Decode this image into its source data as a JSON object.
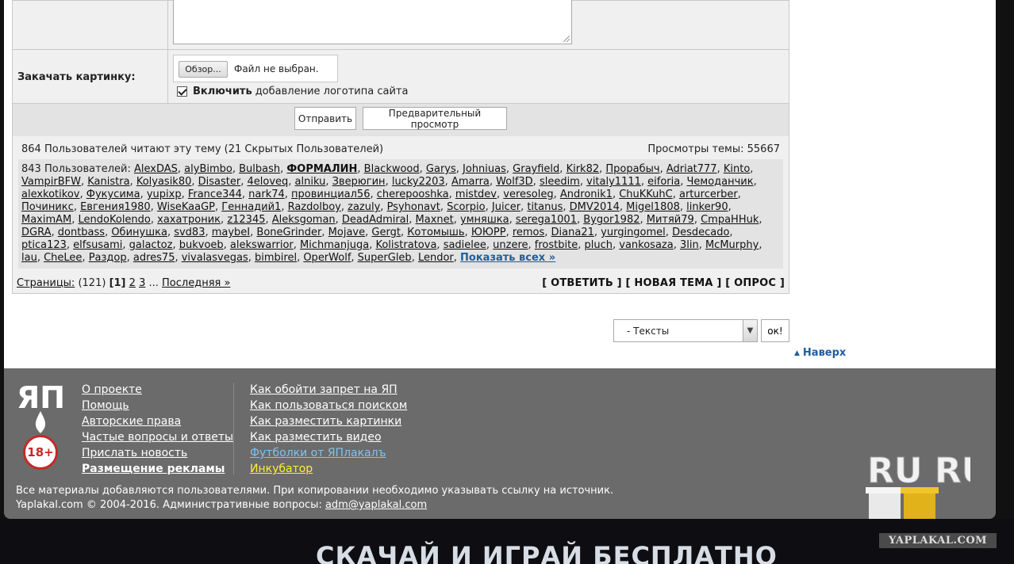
{
  "upload": {
    "label": "Закачать картинку:",
    "browse_label": "Обзор...",
    "file_status": "Файл не выбран.",
    "logo_checkbox_bold": "Включить",
    "logo_checkbox_rest": "добавление логотипа сайта"
  },
  "buttons": {
    "submit": "Отправить",
    "preview": "Предварительный просмотр"
  },
  "readers": {
    "heading": "864 Пользователей читают эту тему (21 Скрытых Пользователей)",
    "views": "Просмотры темы: 55667",
    "users_prefix": "843 Пользователей:",
    "users": [
      "AlexDAS",
      "alyBimbo",
      "Bulbash",
      "ФОРМАЛИН",
      "Blackwood",
      "Garys",
      "Johniuas",
      "Grayfield",
      "Kirk82",
      "Прорабыч",
      "Adriat777",
      "Kinto",
      "VampirBFW",
      "Kanistra",
      "Kolyasik80",
      "Disaster",
      "4eloveq",
      "alniku",
      "Зверюгин",
      "lucky2203",
      "Amarra",
      "Wolf3D",
      "sleedim",
      "vitaly1111",
      "eiforia",
      "Чемоданчик",
      "alexkotikov",
      "Фукусима",
      "yupixp",
      "France344",
      "nark74",
      "провинциал56",
      "cherepooshka",
      "mistdev",
      "veresoleg",
      "Andronik1",
      "ChuKKuhC",
      "arturcerber",
      "Починикс",
      "Евгения1980",
      "WiseKaaGP",
      "Геннадий1",
      "Razdolboy",
      "zazuly",
      "Psyhonavt",
      "Scorpio",
      "Juicer",
      "titanus",
      "DMV2014",
      "Migel1808",
      "linker90",
      "MaximAM",
      "LendoKolendo",
      "хахатроник",
      "z12345",
      "Aleksgoman",
      "DeadAdmiral",
      "Maxnet",
      "умняшка",
      "serega1001",
      "Bygor1982",
      "Митяй79",
      "СmpaHHuk",
      "DGRA",
      "dontbass",
      "Обинушка",
      "svd83",
      "maybeI",
      "BoneGrinder",
      "Mojave",
      "Gergt",
      "Котомышь",
      "ЮЮРР",
      "remos",
      "Diana21",
      "yurgingomel",
      "Desdecado",
      "ptica123",
      "elfsusami",
      "galactoz",
      "bukvoeb",
      "alekswarrior",
      "Michmanjuga",
      "Kolistratova",
      "sadielee",
      "unzere",
      "frostbite",
      "pluch",
      "vankosaza",
      "3lin",
      "McMurphy",
      "lau",
      "CheLee",
      "Раздор",
      "adres75",
      "vivalasvegas",
      "bimbirel",
      "OperWolf",
      "SuperGleb",
      "Lendor"
    ],
    "bold_user": "ФОРМАЛИН",
    "show_all": "Показать всех »"
  },
  "pager": {
    "label": "Страницы:",
    "count": "(121)",
    "current": "[1]",
    "page2": "2",
    "page3": "3",
    "ellipsis": "...",
    "last": "Последняя »"
  },
  "thread_actions": {
    "reply": "[ ОТВЕТИТЬ ]",
    "new_topic": "[ НОВАЯ ТЕМА ]",
    "poll": "[ ОПРОС ]"
  },
  "section_select": {
    "value": "- Тексты",
    "ok_label": "ок!"
  },
  "top_link": "Наверх",
  "footer": {
    "logo_text": "ЯП",
    "age_badge": "18+",
    "col1": [
      "О проекте",
      "Помощь",
      "Авторские права",
      "Частые вопросы и ответы",
      "Прислать новость",
      "Размещение рекламы"
    ],
    "col2": [
      "Как обойти запрет на ЯП",
      "Как пользоваться поиском",
      "Как разместить картинки",
      "Как разместить видео",
      "Футболки от ЯПлакалъ",
      "Инкубатор"
    ],
    "note_line1": "Все материалы добавляются пользователями. При копировании необходимо указывать ссылку на источник.",
    "note_line2_prefix": "Yaplakal.com © 2004-2016. Административные вопросы:",
    "admin_email": "adm@yaplakal.com",
    "ruru_text": "RU RU",
    "colors": {
      "footer_bg": "#6b6b6b",
      "link_blue": "#7cc4f2",
      "link_yellow": "#ffee33"
    }
  },
  "banner": {
    "text": "СКАЧАЙ И ИГРАЙ БЕСПЛАТНО",
    "watermark": "YAPLAKAL.COM"
  }
}
